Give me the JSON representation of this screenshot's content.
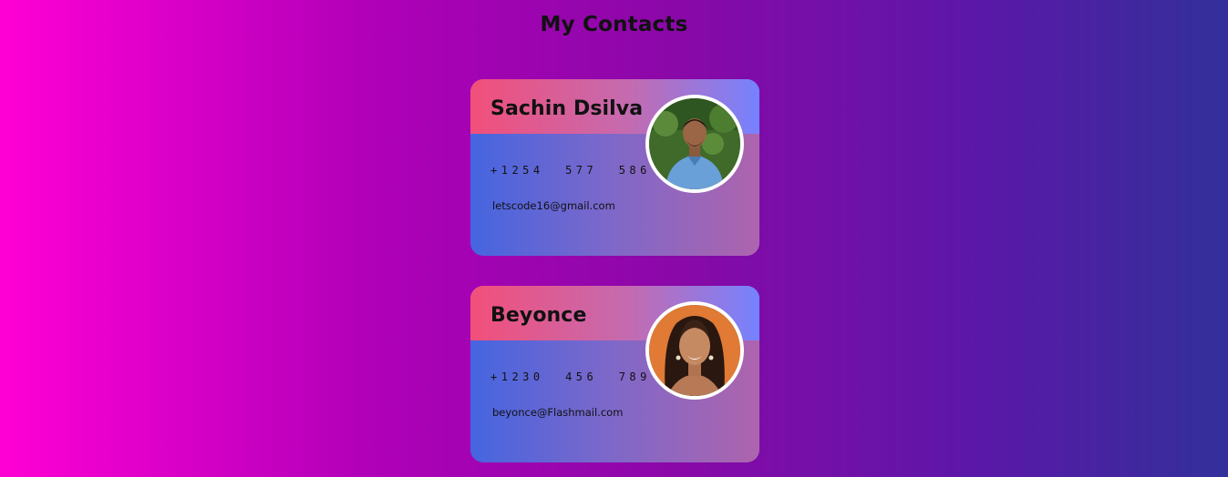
{
  "page": {
    "title": "My Contacts"
  },
  "contacts": [
    {
      "name": "Sachin Dsilva",
      "phone": "+1254  577  586",
      "email": "letscode16@gmail.com",
      "avatar": "man-portrait-photo"
    },
    {
      "name": "Beyonce",
      "phone": "+1230  456  789",
      "email": "beyonce@Flashmail.com",
      "avatar": "woman-portrait-photo"
    }
  ],
  "colors": {
    "background_start": "#ff00d4",
    "background_end": "#32309a",
    "card_header_start": "#f24f7a",
    "card_header_end": "#7582ff",
    "card_body_start": "#4565e0",
    "card_body_end": "#ae64ad"
  }
}
